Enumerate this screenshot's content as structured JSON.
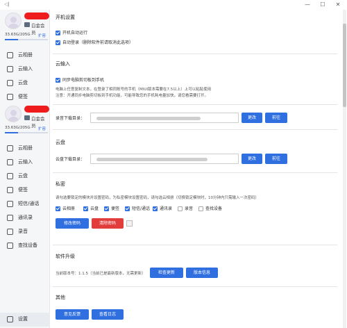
{
  "window": {
    "back_glyph": "◁|",
    "minimize": "—",
    "maximize": "☐",
    "close": "✕"
  },
  "sidebar": {
    "vip_label": "白金会员",
    "storage": "33.63G/205G",
    "expand_label": "扩容",
    "items_top": [
      {
        "label": "云相册"
      },
      {
        "label": "云输入"
      },
      {
        "label": "云盘"
      },
      {
        "label": "便签"
      }
    ],
    "items": [
      {
        "label": "云相册"
      },
      {
        "label": "云输入"
      },
      {
        "label": "云盘"
      },
      {
        "label": "便签"
      },
      {
        "label": "短信/通话"
      },
      {
        "label": "通讯录"
      },
      {
        "label": "录音"
      },
      {
        "label": "查找设备"
      }
    ],
    "settings_label": "设置"
  },
  "startup": {
    "title": "开机设置",
    "autostart": "开机自动运行",
    "autologin": "自动登录（删除软件前请取消此选项）"
  },
  "cloud_input": {
    "title": "云输入",
    "sync_clipboard": "同步电脑剪切板到手机",
    "desc1": "电脑上任意复制文本，在登录了相同账号的手机（MIUI版本需要在7.5以上）上可以粘贴使用",
    "desc2": "注意：开通同步电脑剪切板到手机功能，可能导致您的手机耗电量加快，请您看需要打开。"
  },
  "photo_dir": {
    "label": "录音下载目录：",
    "change": "更改",
    "go": "前往"
  },
  "cloud_disk": {
    "title": "云盘",
    "label": "云盘下载目录：",
    "change": "更改",
    "go": "前往"
  },
  "privacy": {
    "title": "私密",
    "desc": "请勾选要锁定的模块并设置密码，为私密模块设置密码，请勾选云相册（切换锁定模块时，10分钟内只需输入一次密码）",
    "modules": [
      {
        "label": "云相册",
        "checked": true
      },
      {
        "label": "云盘",
        "checked": true
      },
      {
        "label": "便签",
        "checked": true
      },
      {
        "label": "短信/通话",
        "checked": true
      },
      {
        "label": "通讯录",
        "checked": true
      },
      {
        "label": "录音",
        "checked": false
      },
      {
        "label": "查找设备",
        "checked": false
      }
    ],
    "change_pw": "修改密码",
    "clear_pw": "清除密码"
  },
  "upgrade": {
    "title": "软件升级",
    "version": "当前版本号：1.1.5（当前已是最新版本，无需更新）",
    "check": "检查更新",
    "info": "版本信息"
  },
  "other": {
    "title": "其他",
    "feedback": "意见反馈",
    "log": "查看日志"
  }
}
